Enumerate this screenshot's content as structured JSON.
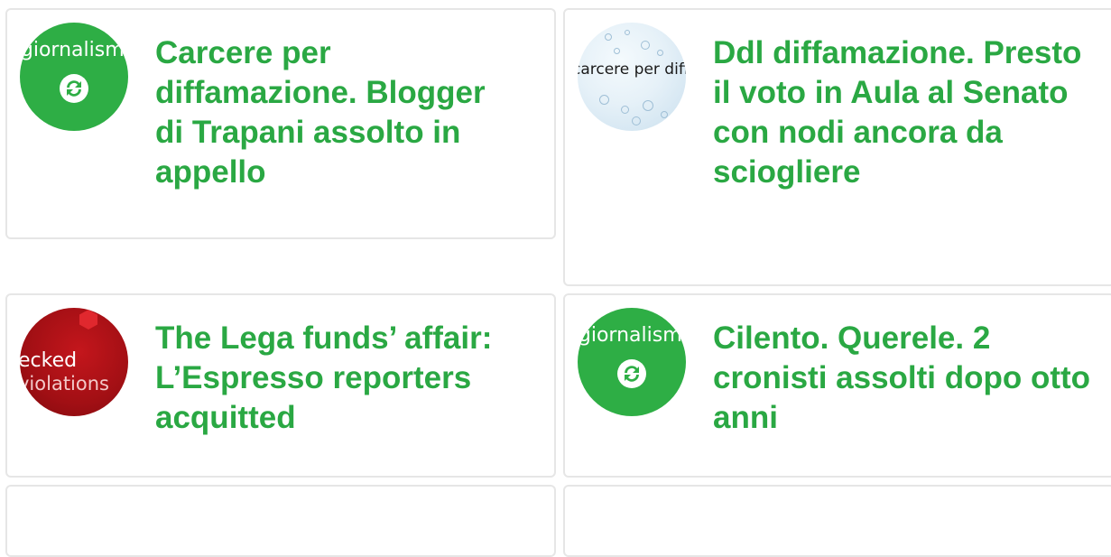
{
  "accent_color": "#2aa843",
  "articles": [
    {
      "title": "Carcere per diffamazione. Blogger di Trapani assolto in appello",
      "thumb_text": "giornalismo"
    },
    {
      "title": "Ddl diffamazione. Presto il voto in Aula al Senato con nodi ancora da sciogliere",
      "thumb_text": "carcere per diffamazione"
    },
    {
      "title": "The Lega funds’ affair: L’Espresso reporters acquitted",
      "thumb_text_1": "ecked",
      "thumb_text_2": "violations"
    },
    {
      "title": "Cilento. Querele. 2 cronisti assolti dopo otto anni",
      "thumb_text": "giornalismo"
    }
  ]
}
